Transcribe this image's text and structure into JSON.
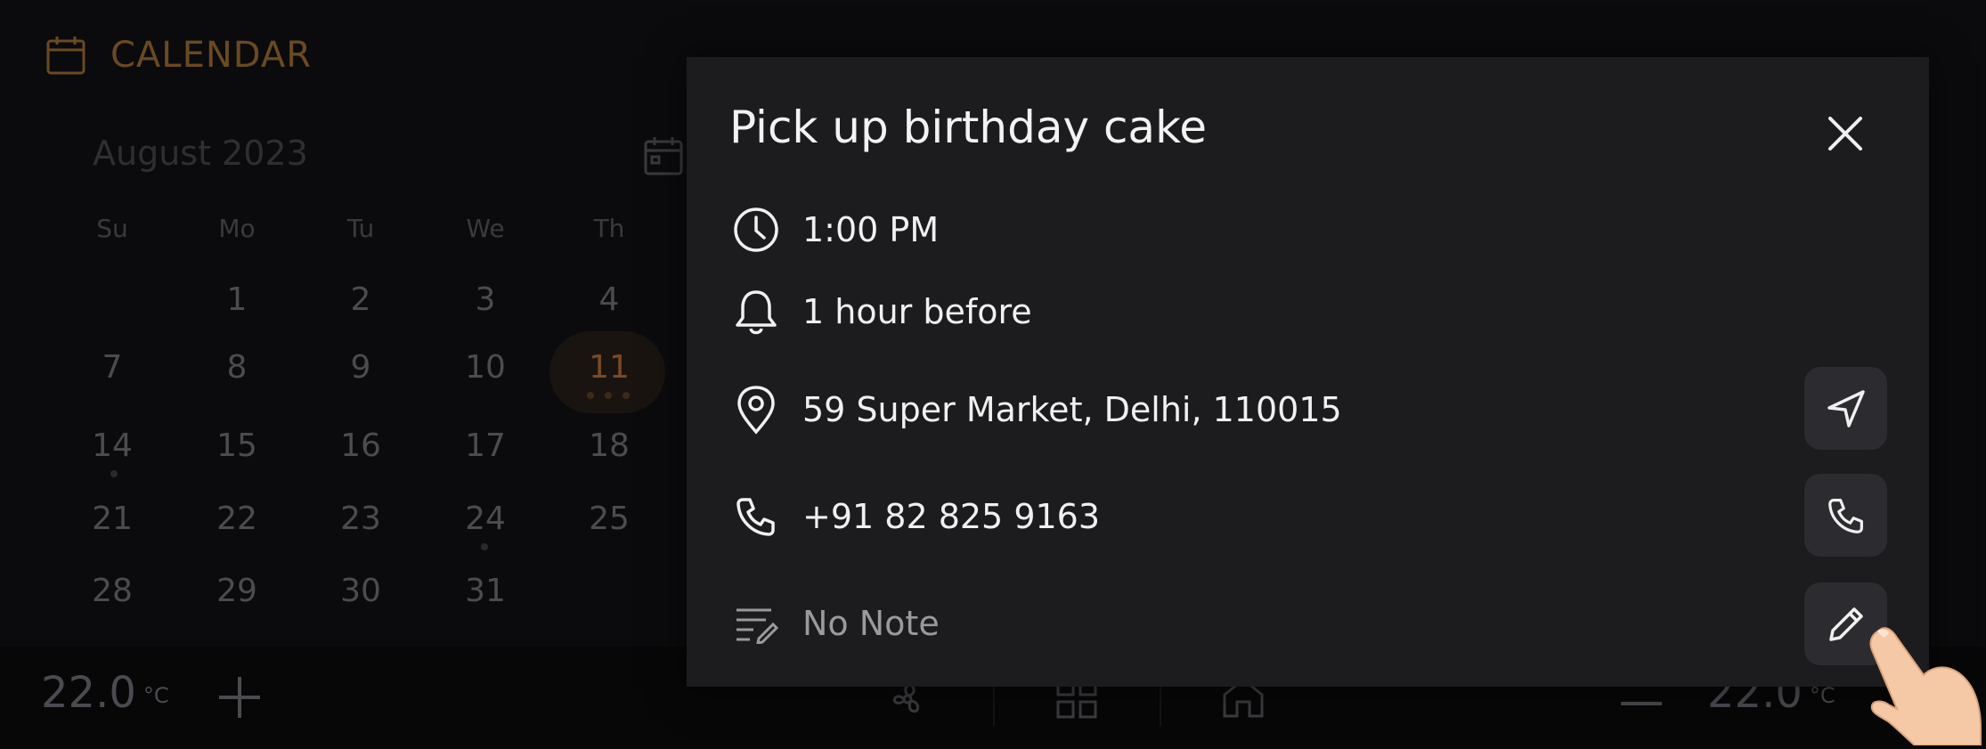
{
  "app": {
    "title": "CALENDAR"
  },
  "calendar": {
    "month_label": "August 2023",
    "weekdays": [
      "Su",
      "Mo",
      "Tu",
      "We",
      "Th"
    ],
    "days": [
      "1",
      "2",
      "3",
      "4",
      "7",
      "8",
      "9",
      "10",
      "11",
      "14",
      "15",
      "16",
      "17",
      "18",
      "21",
      "22",
      "23",
      "24",
      "25",
      "28",
      "29",
      "30",
      "31"
    ],
    "today": "11"
  },
  "bottom_bar": {
    "left_temp": "22.0",
    "right_temp": "22.0",
    "unit": "°C"
  },
  "event": {
    "title": "Pick up birthday cake",
    "time": "1:00 PM",
    "reminder": "1 hour before",
    "location": "59  Super Market, Delhi, 110015",
    "phone": "+91 82 825 9163",
    "note": "No Note"
  },
  "icons": {
    "close": "close-icon",
    "clock": "clock-icon",
    "bell": "bell-icon",
    "location": "location-pin-icon",
    "phone": "phone-icon",
    "note": "note-icon",
    "navigate": "navigate-icon",
    "call": "phone-icon",
    "edit": "pencil-icon"
  },
  "colors": {
    "accent": "#7a4a26",
    "modal_bg": "#1c1c1f",
    "button_bg": "#2c2c30"
  }
}
